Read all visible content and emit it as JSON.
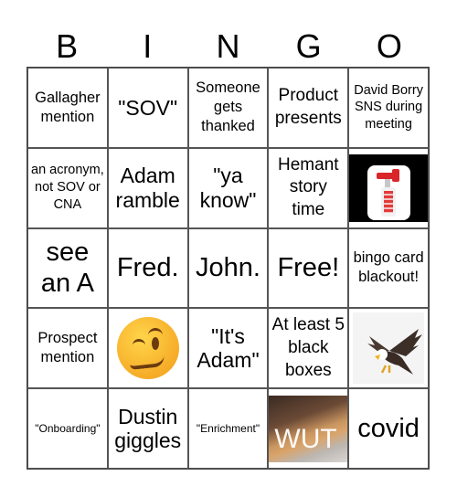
{
  "header": {
    "letters": [
      "B",
      "I",
      "N",
      "G",
      "O"
    ]
  },
  "cells": [
    {
      "text": "Gallagher mention"
    },
    {
      "text": "\"SOV\""
    },
    {
      "text": "Someone gets thanked"
    },
    {
      "text": "Product presents"
    },
    {
      "text": "David Borry SNS during meeting"
    },
    {
      "text": "an acronym, not SOV or CNA"
    },
    {
      "text": "Adam ramble"
    },
    {
      "text": "\"ya know\""
    },
    {
      "text": "Hemant story time"
    },
    {
      "image": "air-horn-image"
    },
    {
      "text": "see an A"
    },
    {
      "text": "Fred."
    },
    {
      "text": "John."
    },
    {
      "text": "Free!"
    },
    {
      "text": "bingo card blackout!"
    },
    {
      "text": "Prospect mention"
    },
    {
      "image": "woozy-face-emoji"
    },
    {
      "text": "\"It's Adam\""
    },
    {
      "text": "At least 5 black boxes"
    },
    {
      "image": "eagle-image"
    },
    {
      "text": "\"Onboarding\""
    },
    {
      "text": "Dustin giggles"
    },
    {
      "text": "\"Enrichment\""
    },
    {
      "image": "wut-dog-image",
      "caption": "WUT"
    },
    {
      "text": "covid"
    }
  ]
}
